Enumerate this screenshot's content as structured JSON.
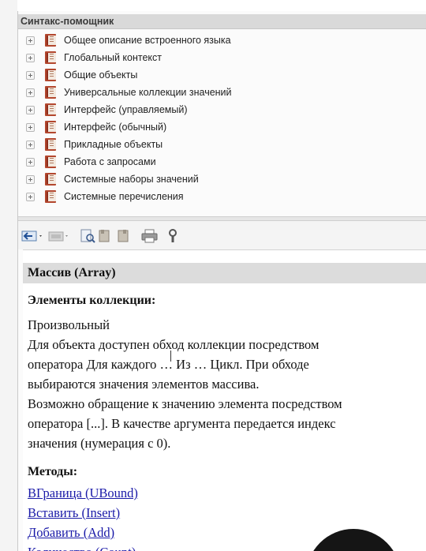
{
  "panel_title": "Синтакс-помощник",
  "tree": {
    "items": [
      {
        "label": "Общее описание встроенного языка"
      },
      {
        "label": "Глобальный контекст"
      },
      {
        "label": "Общие объекты"
      },
      {
        "label": "Универсальные коллекции значений"
      },
      {
        "label": "Интерфейс (управляемый)"
      },
      {
        "label": "Интерфейс (обычный)"
      },
      {
        "label": "Прикладные объекты"
      },
      {
        "label": "Работа с запросами"
      },
      {
        "label": "Системные наборы значений"
      },
      {
        "label": "Системные перечисления"
      }
    ]
  },
  "toolbar": {
    "icons": [
      "back-arrow-icon",
      "forward-icon",
      "find-in-tree-icon",
      "book-prev-icon",
      "book-next-icon",
      "print-icon",
      "settings-wrench-icon"
    ]
  },
  "article": {
    "title": "Массив (Array)",
    "collection_heading": "Элементы коллекции:",
    "lines": [
      "Произвольный",
      "Для объекта доступен обход коллекции посредством",
      "оператора Для каждого … Из … Цикл. При обходе",
      "выбираются значения элементов массива.",
      "Возможно обращение к значению элемента посредством",
      "оператора [...]. В качестве аргумента передается индекс",
      "значения (нумерация с 0)."
    ],
    "methods_heading": "Методы:",
    "methods": [
      {
        "label": "ВГраница (UBound)"
      },
      {
        "label": "Вставить (Insert)"
      },
      {
        "label": "Добавить (Add)"
      },
      {
        "label": "Количество (Count)"
      }
    ]
  },
  "colors": {
    "link": "#1a1aa8",
    "heading_bar": "#dcdcdc",
    "book_icon": "#b3472e"
  }
}
